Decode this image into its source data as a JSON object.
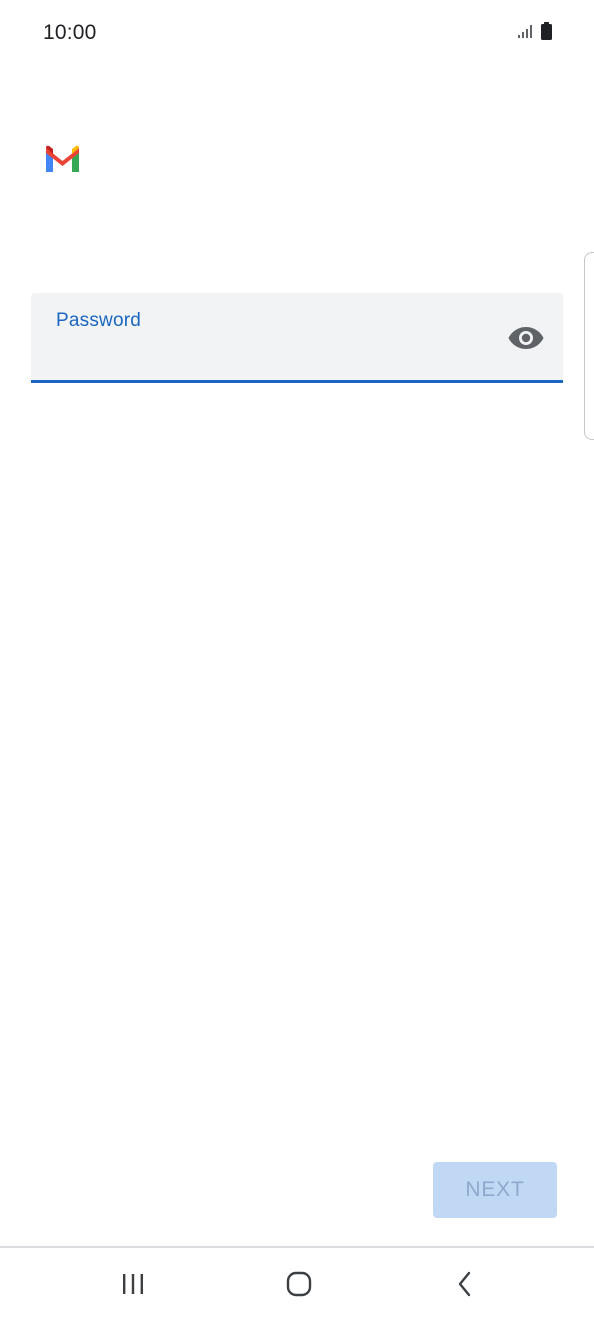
{
  "status_bar": {
    "time": "10:00",
    "signal_icon": "signal-icon",
    "battery_icon": "battery-icon"
  },
  "app": {
    "logo_icon": "gmail-logo-icon"
  },
  "password_field": {
    "label": "Password",
    "value": "",
    "visibility_icon": "eye-icon"
  },
  "actions": {
    "next_label": "NEXT"
  },
  "nav_bar": {
    "recents_icon": "recents-icon",
    "home_icon": "home-icon",
    "back_icon": "back-icon"
  },
  "colors": {
    "accent": "#1a66c0",
    "field_background": "#f1f3f4",
    "next_disabled_bg": "#c1d8f4",
    "next_disabled_text": "#8ea9cd"
  }
}
